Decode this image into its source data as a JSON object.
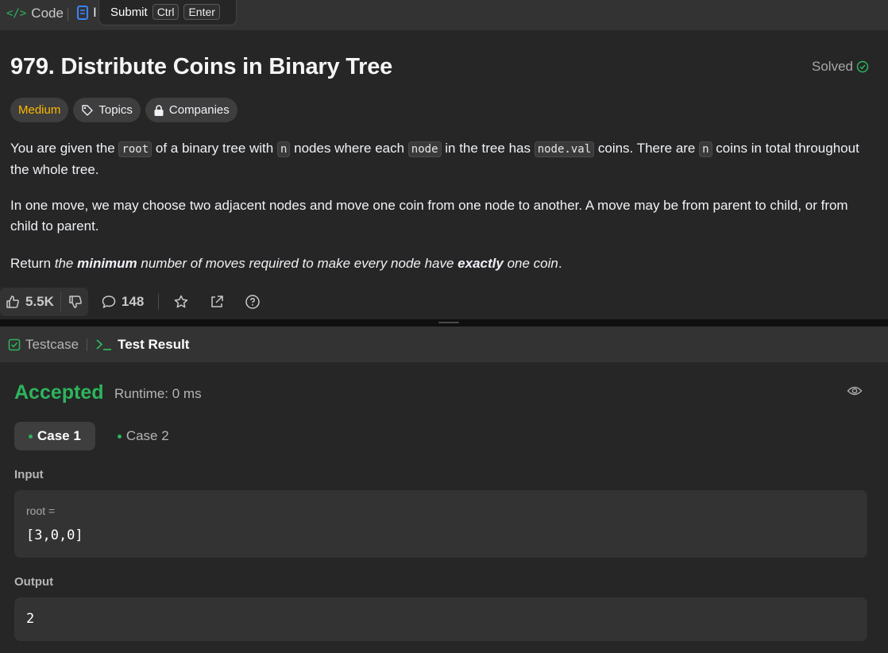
{
  "tabs": {
    "code_label": "Code",
    "desc_label_partial": "I"
  },
  "tooltip": {
    "label": "Submit",
    "key1": "Ctrl",
    "key2": "Enter"
  },
  "problem": {
    "title": "979. Distribute Coins in Binary Tree",
    "status": "Solved",
    "difficulty": "Medium",
    "topics_label": "Topics",
    "companies_label": "Companies",
    "p1": {
      "t1": "You are given the ",
      "c1": "root",
      "t2": " of a binary tree with ",
      "c2": "n",
      "t3": " nodes where each ",
      "c3": "node",
      "t4": " in the tree has ",
      "c4": "node.val",
      "t5": " coins. There are ",
      "c5": "n",
      "t6": " coins in total throughout the whole tree."
    },
    "p2": "In one move, we may choose two adjacent nodes and move one coin from one node to another. A move may be from parent to child, or from child to parent.",
    "p3": {
      "t1": "Return ",
      "e1": "the ",
      "b1": "minimum",
      "e2": " number of moves required to make every node have ",
      "b2": "exactly",
      "e3": " one coin",
      "t2": "."
    }
  },
  "actions": {
    "likes": "5.5K",
    "comments": "148"
  },
  "bottom_tabs": {
    "testcase": "Testcase",
    "result": "Test Result"
  },
  "result": {
    "status": "Accepted",
    "runtime": "Runtime: 0 ms",
    "cases": [
      "Case 1",
      "Case 2"
    ],
    "input_label": "Input",
    "input_var": "root =",
    "input_value": "[3,0,0]",
    "output_label": "Output",
    "output_value": "2"
  },
  "colors": {
    "accent_green": "#2db55d",
    "medium_yellow": "#ffb800",
    "panel_bg": "#262626",
    "toolbar_bg": "#333333"
  },
  "icons": [
    "code-icon",
    "description-icon",
    "check-circle-icon",
    "tag-icon",
    "lock-icon",
    "thumbs-up-icon",
    "thumbs-down-icon",
    "comment-icon",
    "star-icon",
    "share-icon",
    "help-icon",
    "checkbox-icon",
    "terminal-icon",
    "eye-icon"
  ]
}
